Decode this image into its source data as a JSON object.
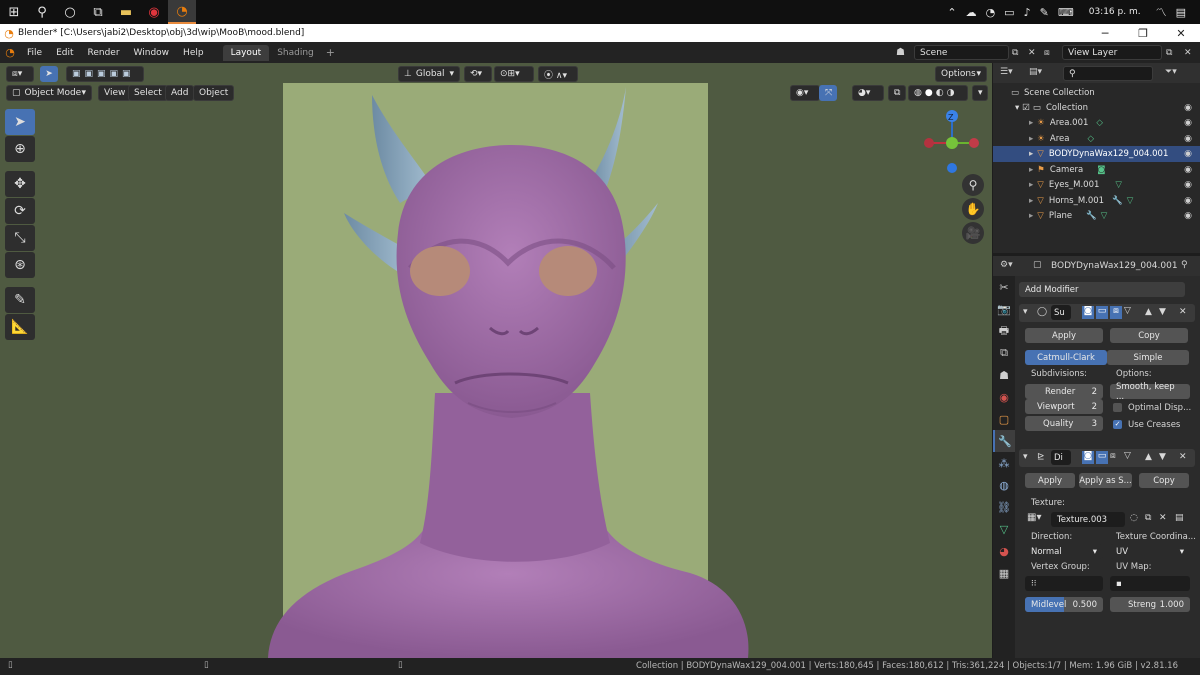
{
  "taskbar": {
    "clock": "03:16 p. m."
  },
  "window": {
    "title": "Blender* [C:\\Users\\jabi2\\Desktop\\obj\\3d\\wip\\MooB\\mood.blend]"
  },
  "menu": [
    "File",
    "Edit",
    "Render",
    "Window",
    "Help"
  ],
  "workspaces": [
    {
      "label": "Layout",
      "active": true
    },
    {
      "label": "Shading",
      "active": false
    }
  ],
  "scene": {
    "label": "Scene"
  },
  "view_layer": {
    "label": "View Layer"
  },
  "viewport": {
    "transform_orientation": "Global",
    "options_label": "Options",
    "mode": "Object Mode",
    "menus": [
      "View",
      "Select",
      "Add",
      "Object"
    ],
    "background_color": "#4f5a41",
    "camera_frame_color": "#9aab78"
  },
  "gizmo": {
    "z_label": "Z"
  },
  "outliner": {
    "root": "Scene Collection",
    "collection": "Collection",
    "objects": [
      {
        "name": "Area.001",
        "icon": "light-icon",
        "selected": false
      },
      {
        "name": "Area",
        "icon": "light-icon",
        "selected": false
      },
      {
        "name": "BODYDynaWax129_004.001",
        "icon": "mesh-icon",
        "selected": true
      },
      {
        "name": "Camera",
        "icon": "camera-icon",
        "selected": false
      },
      {
        "name": "Eyes_M.001",
        "icon": "mesh-icon",
        "selected": false
      },
      {
        "name": "Horns_M.001",
        "icon": "mesh-icon",
        "selected": false
      },
      {
        "name": "Plane",
        "icon": "mesh-icon",
        "selected": false
      }
    ]
  },
  "properties": {
    "object_name": "BODYDynaWax129_004.001",
    "add_modifier": "Add Modifier",
    "subsurf": {
      "short_name": "Su",
      "apply": "Apply",
      "copy": "Copy",
      "catmull": "Catmull-Clark",
      "simple": "Simple",
      "subdivisions_label": "Subdivisions:",
      "options_label": "Options:",
      "render_label": "Render",
      "render_value": "2",
      "viewport_label": "Viewport",
      "viewport_value": "2",
      "quality_label": "Quality",
      "quality_value": "3",
      "smooth_option": "Smooth, keep ...",
      "optimal_label": "Optimal Disp...",
      "creases_label": "Use Creases"
    },
    "displace": {
      "short_name": "Di",
      "apply": "Apply",
      "apply_shape": "Apply as S...",
      "copy": "Copy",
      "texture_label": "Texture:",
      "texture_name": "Texture.003",
      "direction_label": "Direction:",
      "texcoords_label": "Texture Coordina...",
      "direction_value": "Normal",
      "texcoords_value": "UV",
      "vgroup_label": "Vertex Group:",
      "uvmap_label": "UV Map:",
      "midlevel_label": "Midlevel",
      "midlevel_value": "0.500",
      "midlevel_fraction": 0.5,
      "strength_label": "Streng",
      "strength_value": "1.000"
    }
  },
  "statusbar": {
    "text": "Collection | BODYDynaWax129_004.001 | Verts:180,645 | Faces:180,612 | Tris:361,224 | Objects:1/7 | Mem: 1.96 GiB | v2.81.16"
  },
  "colors": {
    "accent": "#4772b3",
    "skin": "#9c6aa3",
    "horn": "#7e9db5",
    "eye": "#b68a79"
  }
}
